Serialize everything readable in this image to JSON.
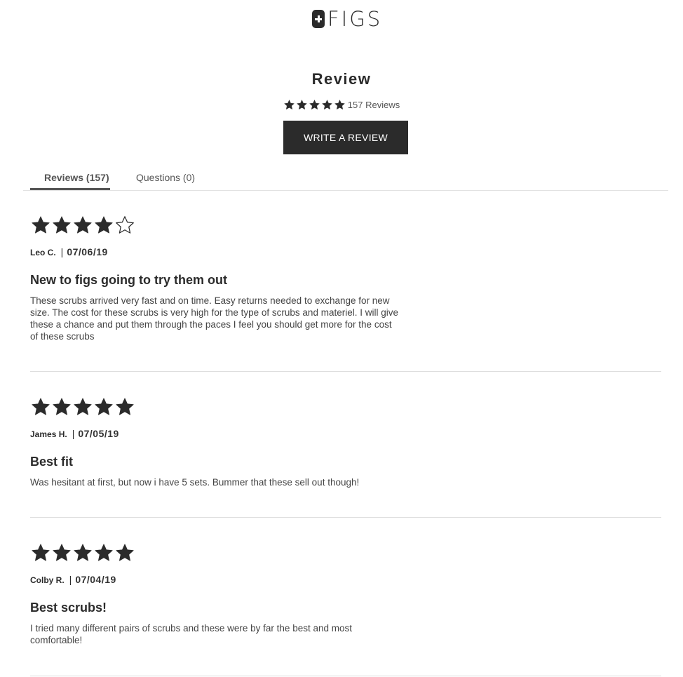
{
  "brand": {
    "name": "FIGS",
    "logo_icon": "plus-badge-icon"
  },
  "heading": "Review",
  "summary": {
    "rating": 5,
    "count_label": "157 Reviews"
  },
  "write_review_label": "WRITE A REVIEW",
  "tabs": [
    {
      "label": "Reviews (157)",
      "active": true
    },
    {
      "label": "Questions (0)",
      "active": false
    }
  ],
  "colors": {
    "ink": "#2b2b2b",
    "divider": "#dedede"
  },
  "reviews": [
    {
      "rating": 4,
      "author": "Leo C.",
      "separator": "|",
      "date": "07/06/19",
      "title": "New to figs going to try them out",
      "body": "These scrubs arrived very fast and on time. Easy returns needed to exchange for new size. The cost for these scrubs is very high for the type of scrubs and materiel. I will give these a chance and put them through the paces I feel you should get more for the cost of these scrubs"
    },
    {
      "rating": 5,
      "author": "James H.",
      "separator": "|",
      "date": "07/05/19",
      "title": "Best fit",
      "body": "Was hesitant at first, but now i have 5 sets. Bummer that these sell out though!"
    },
    {
      "rating": 5,
      "author": "Colby R.",
      "separator": "|",
      "date": "07/04/19",
      "title": "Best scrubs!",
      "body": "I tried many different pairs of scrubs and these were by far the best and most comfortable!"
    }
  ]
}
